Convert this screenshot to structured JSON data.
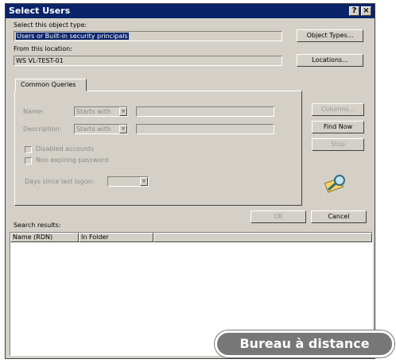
{
  "window": {
    "title": "Select Users",
    "help_btn": "?",
    "close_btn": "×"
  },
  "object_type": {
    "label": "Select this object type:",
    "value": "Users or Built-in security principals",
    "button": "Object Types..."
  },
  "location": {
    "label": "From this location:",
    "value": "WS VL-TEST-01",
    "button": "Locations..."
  },
  "tab": {
    "label": "Common Queries"
  },
  "queries": {
    "name_label": "Name:",
    "name_mode": "Starts with",
    "name_value": "",
    "desc_label": "Description:",
    "desc_mode": "Starts with",
    "desc_value": "",
    "disabled_accounts": "Disabled accounts",
    "non_expiring": "Non expiring password",
    "days_label": "Days since last logon:",
    "days_value": ""
  },
  "side_buttons": {
    "columns": "Columns...",
    "find_now": "Find Now",
    "stop": "Stop"
  },
  "dialog_buttons": {
    "ok": "OK",
    "cancel": "Cancel"
  },
  "results": {
    "label": "Search results:",
    "columns": [
      "Name (RDN)",
      "In Folder"
    ]
  },
  "overlay": {
    "badge": "Bureau à distance"
  },
  "icons": {
    "search": "magnifier-icon"
  }
}
